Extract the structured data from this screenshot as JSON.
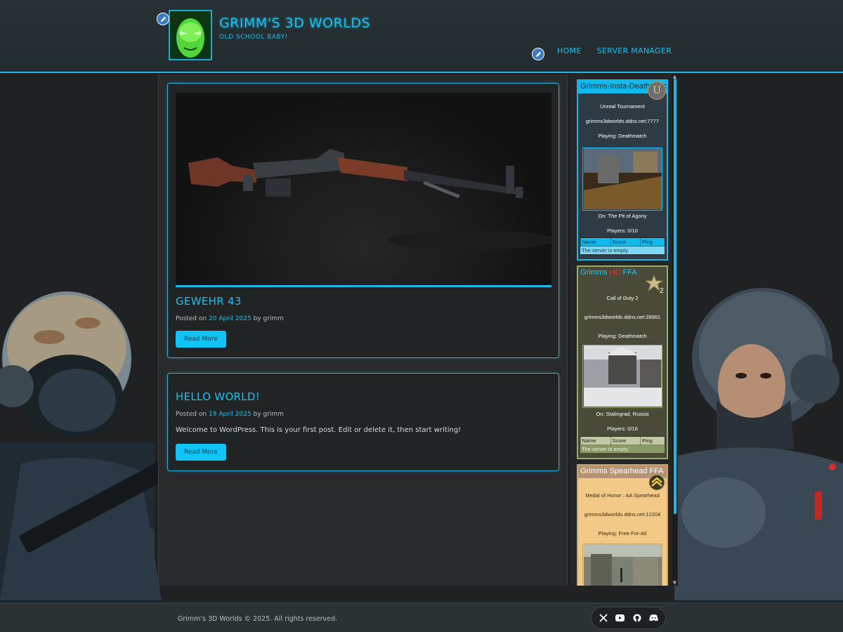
{
  "header": {
    "site_title": "GRIMM'S 3D WORLDS",
    "tagline": "OLD SCHOOL BABY!",
    "nav": [
      {
        "label": "HOME"
      },
      {
        "label": "SERVER MANAGER"
      }
    ]
  },
  "posts": [
    {
      "title": "GEWEHR 43",
      "posted_on": "Posted on",
      "date": "20 April 2025",
      "by": "by",
      "author": "grimm",
      "read_more": "Read More"
    },
    {
      "title": "HELLO WORLD!",
      "posted_on": "Posted on",
      "date": "19 April 2025",
      "by": "by",
      "author": "grimm",
      "excerpt": "Welcome to WordPress. This is your first post. Edit or delete it, then start writing!",
      "read_more": "Read More"
    }
  ],
  "servers": [
    {
      "name": "Grimms-Insta-Deathmatch",
      "game": "Unreal Tournament",
      "address": "grimms3dworlds.ddns.net:7777",
      "playing": "Playing: Deathmatch",
      "map": "On: The Pit of Agony",
      "players": "Players: 0/10",
      "columns": [
        "Name",
        "Score",
        "Ping"
      ],
      "empty": "The server is empty.",
      "icon": "unreal-logo-icon",
      "colors": {
        "accent": "#12b9ec",
        "bg": "#2e3b44"
      }
    },
    {
      "name_parts": [
        "Grimms ",
        "HC",
        " FFA"
      ],
      "game": "Call of Duty 2",
      "address": "grimms3dworlds.ddns.net:28961",
      "playing": "Playing: Deathmatch",
      "map": "On: Stalingrad, Russia",
      "players": "Players: 0/16",
      "columns": [
        "Name",
        "Score",
        "Ping"
      ],
      "empty": "The server is empty.",
      "icon": "cod2-star-icon",
      "colors": {
        "accent": "#9aa86a",
        "bg": "#4a4a38",
        "hc": "#e03a2a",
        "title": "#12c8f4"
      }
    },
    {
      "name": "Grimms Spearhead FFA",
      "game": "Medal of Honor : AA Spearhead",
      "address": "grimms3dworlds.ddns.net:12204",
      "playing": "Playing: Free-For-All",
      "icon": "sergeant-chevron-icon",
      "colors": {
        "accent": "#c9a36a",
        "bg": "#f3c988"
      }
    }
  ],
  "footer": {
    "copyright": "Grimm's 3D Worlds © 2025. All rights reserved.",
    "social": [
      "x-icon",
      "youtube-icon",
      "github-icon",
      "discord-icon"
    ]
  }
}
